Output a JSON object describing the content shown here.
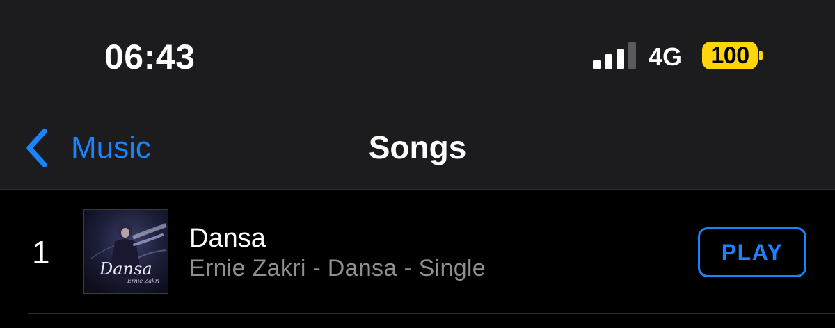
{
  "status_bar": {
    "time": "06:43",
    "network": "4G",
    "battery_level": "100",
    "signal_bars_active": 3,
    "signal_bars_total": 4
  },
  "navigation": {
    "back_label": "Music",
    "back_icon": "chevron-left-icon",
    "title": "Songs"
  },
  "songs": [
    {
      "number": "1",
      "title": "Dansa",
      "subtitle": "Ernie Zakri - Dansa - Single",
      "artwork_title": "Dansa",
      "artwork_artist": "Ernie Zakri",
      "action_label": "PLAY"
    }
  ],
  "colors": {
    "accent": "#1a84ff",
    "battery_fill": "#ffd60a",
    "background": "#000000",
    "header_background": "#1c1c1e",
    "secondary_text": "#8e8e93",
    "signal_active": "#ffffff",
    "signal_inactive": "#5a5a5e"
  }
}
